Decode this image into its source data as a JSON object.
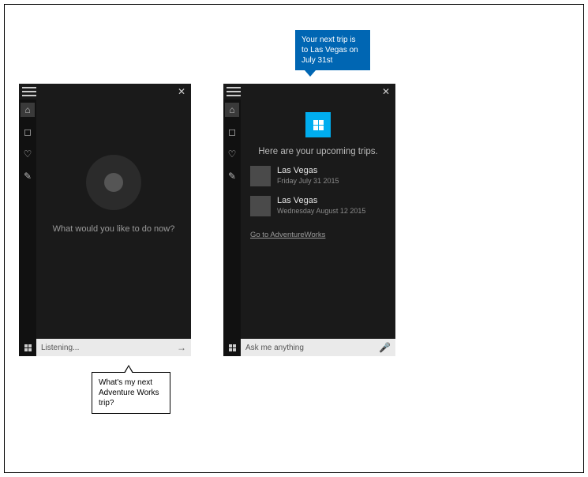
{
  "blue_bubble": "Your next trip is to Las Vegas on July 31st",
  "white_bubble": "What's my next Adventure Works trip?",
  "left": {
    "prompt": "What would you like to do now?",
    "search_text": "Listening...",
    "search_icon": "→"
  },
  "right": {
    "heading": "Here are your upcoming trips.",
    "trips": [
      {
        "dest": "Las Vegas",
        "date": "Friday July 31 2015"
      },
      {
        "dest": "Las Vegas",
        "date": "Wednesday August 12 2015"
      }
    ],
    "goto": "Go to AdventureWorks",
    "search_placeholder": "Ask me anything",
    "search_icon": "🎤"
  },
  "icons": {
    "home": "⌂",
    "user": "◻",
    "bulb": "♡",
    "star": "✎"
  }
}
